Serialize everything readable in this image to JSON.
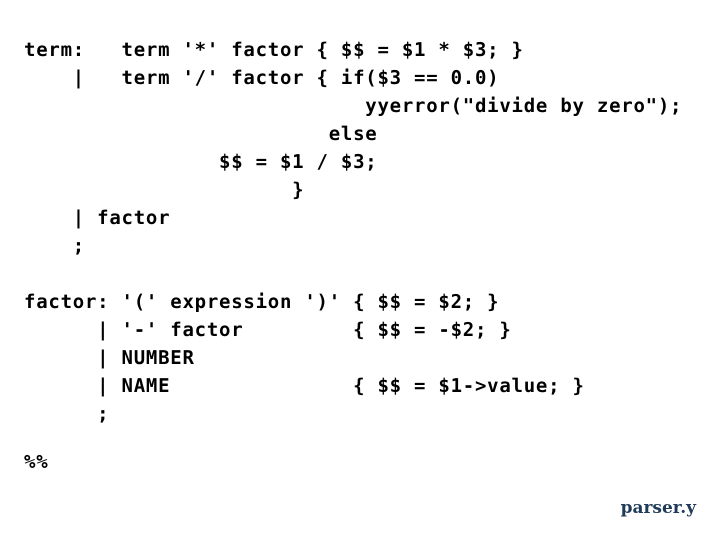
{
  "slide": {
    "background_color": "#ffffff",
    "text_color": "#000000",
    "footer_color": "#1f3b57",
    "footer_label": "parser.y"
  },
  "code": {
    "language": "yacc-grammar",
    "lines": [
      "term:   term '*' factor { $$ = $1 * $3; }",
      "    |   term '/' factor { if($3 == 0.0)",
      "                            yyerror(\"divide by zero\");",
      "                         else",
      "                $$ = $1 / $3;",
      "                      }",
      "    | factor",
      "    ;",
      "",
      "factor: '(' expression ')' { $$ = $2; }",
      "      | '-' factor         { $$ = -$2; }",
      "      | NUMBER",
      "      | NAME               { $$ = $1->value; }",
      "      ;"
    ]
  },
  "section_marker": {
    "lines": [
      "%%"
    ]
  }
}
